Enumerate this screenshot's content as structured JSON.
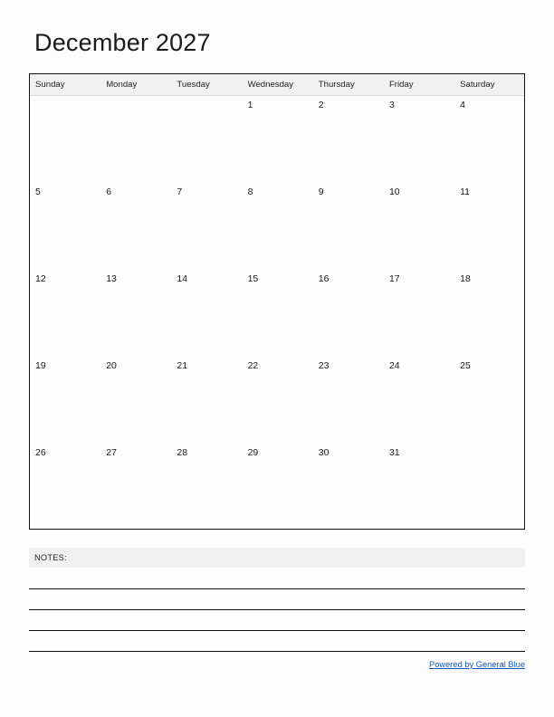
{
  "document": {
    "title": "December 2027",
    "month": "December",
    "year": "2027"
  },
  "calendar": {
    "weekday_headers": [
      "Sunday",
      "Monday",
      "Tuesday",
      "Wednesday",
      "Thursday",
      "Friday",
      "Saturday"
    ],
    "weeks": [
      [
        "",
        "",
        "",
        "1",
        "2",
        "3",
        "4"
      ],
      [
        "5",
        "6",
        "7",
        "8",
        "9",
        "10",
        "11"
      ],
      [
        "12",
        "13",
        "14",
        "15",
        "16",
        "17",
        "18"
      ],
      [
        "19",
        "20",
        "21",
        "22",
        "23",
        "24",
        "25"
      ],
      [
        "26",
        "27",
        "28",
        "29",
        "30",
        "31",
        ""
      ]
    ]
  },
  "notes": {
    "label": "NOTES:",
    "line_count": 4
  },
  "footer": {
    "link_text": "Powered by General Blue"
  },
  "colors": {
    "header_background": "#f1f1f1",
    "grid_border": "#111111",
    "text": "#1a1a1a",
    "link": "#1155cc",
    "page_background": "#fdfdfd"
  }
}
